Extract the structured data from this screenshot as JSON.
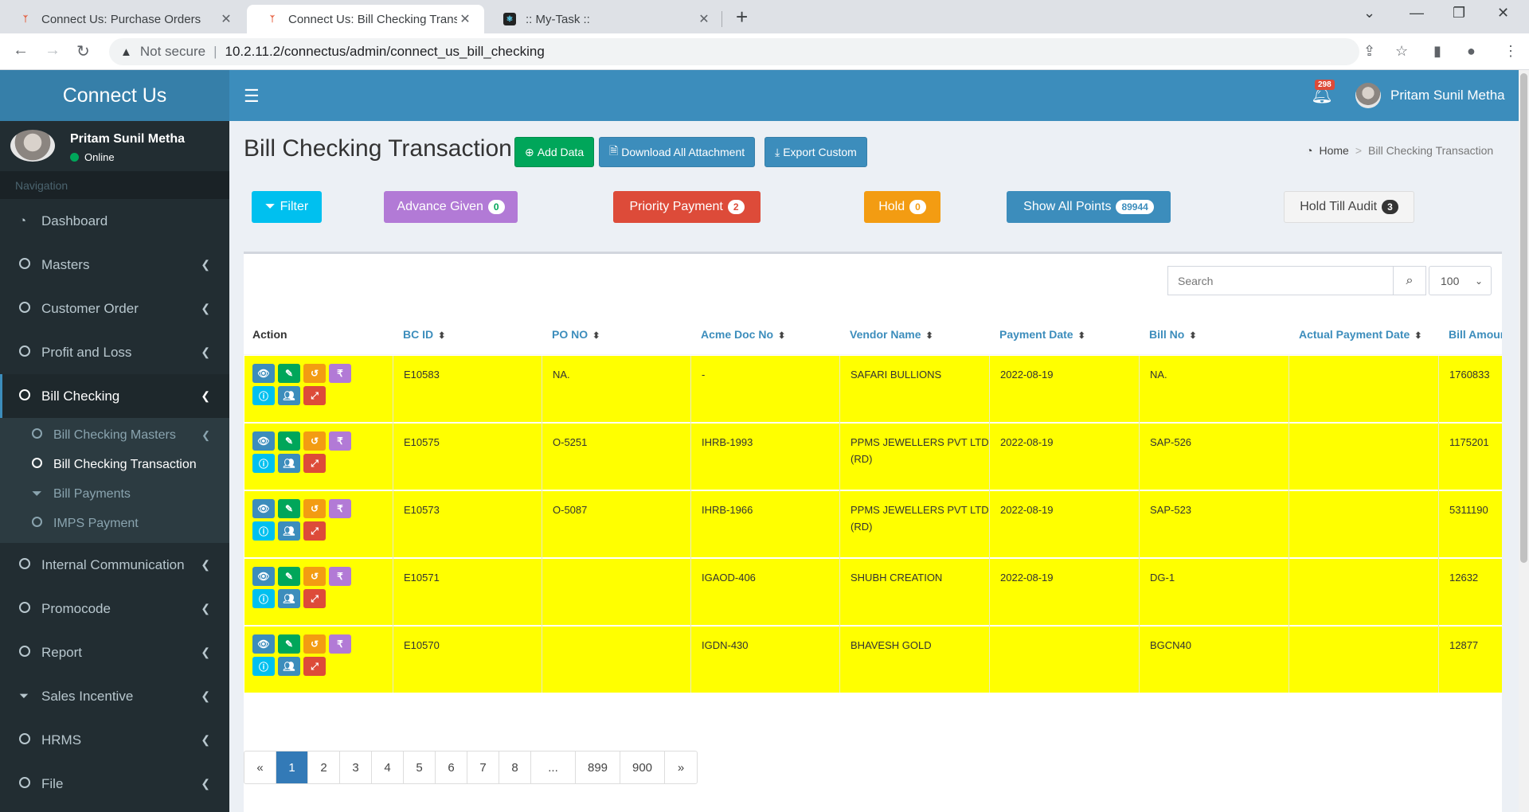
{
  "browser": {
    "tabs": [
      {
        "title": "Connect Us: Purchase Orders"
      },
      {
        "title": "Connect Us: Bill Checking Transac"
      },
      {
        "title": ":: My-Task ::"
      }
    ],
    "security": "Not secure",
    "url": "10.2.11.2/connectus/admin/connect_us_bill_checking"
  },
  "sidebar": {
    "brand": "Connect Us",
    "user_name": "Pritam Sunil Metha",
    "status": "Online",
    "nav_header": "Navigation",
    "items": [
      {
        "label": "Dashboard",
        "icon": "dashboard-icon"
      },
      {
        "label": "Masters",
        "icon": "circle-icon"
      },
      {
        "label": "Customer Order",
        "icon": "circle-icon"
      },
      {
        "label": "Profit and Loss",
        "icon": "circle-icon"
      },
      {
        "label": "Bill Checking",
        "icon": "circle-icon"
      },
      {
        "label": "Internal Communication",
        "icon": "circle-icon"
      },
      {
        "label": "Promocode",
        "icon": "circle-icon"
      },
      {
        "label": "Report",
        "icon": "circle-icon"
      },
      {
        "label": "Sales Incentive",
        "icon": "filter-icon"
      },
      {
        "label": "HRMS",
        "icon": "circle-icon"
      },
      {
        "label": "File",
        "icon": "circle-icon"
      }
    ],
    "sub_items": [
      {
        "label": "Bill Checking Masters"
      },
      {
        "label": "Bill Checking Transaction"
      },
      {
        "label": "Bill Payments"
      },
      {
        "label": "IMPS Payment"
      }
    ]
  },
  "header": {
    "notification_count": "298",
    "user_name": "Pritam Sunil Metha"
  },
  "content": {
    "title": "Bill Checking Transaction",
    "add_data": "Add Data",
    "download_all": "Download All Attachment",
    "export_custom": "Export Custom",
    "breadcrumb_home": "Home",
    "breadcrumb_current": "Bill Checking Transaction"
  },
  "filters": {
    "filter": "Filter",
    "advance_given": {
      "label": "Advance Given",
      "count": "0"
    },
    "priority_payment": {
      "label": "Priority Payment",
      "count": "2"
    },
    "hold": {
      "label": "Hold",
      "count": "0"
    },
    "show_all_points": {
      "label": "Show All Points",
      "count": "89944"
    },
    "hold_till_audit": {
      "label": "Hold Till Audit",
      "count": "3"
    }
  },
  "table": {
    "search_placeholder": "Search",
    "page_size": "100",
    "columns": [
      "Action",
      "BC ID",
      "PO NO",
      "Acme Doc No",
      "Vendor Name",
      "Payment Date",
      "Bill No",
      "Actual Payment Date",
      "Bill Amour"
    ],
    "rows": [
      {
        "bc_id": "E10583",
        "po_no": "NA.",
        "acme_doc": "-",
        "vendor": "SAFARI BULLIONS",
        "payment_date": "2022-08-19",
        "bill_no": "NA.",
        "actual_date": "",
        "amount": "1760833"
      },
      {
        "bc_id": "E10575",
        "po_no": "O-5251",
        "acme_doc": "IHRB-1993",
        "vendor": "PPMS JEWELLERS PVT LTD (RD)",
        "payment_date": "2022-08-19",
        "bill_no": "SAP-526",
        "actual_date": "",
        "amount": "1175201"
      },
      {
        "bc_id": "E10573",
        "po_no": "O-5087",
        "acme_doc": "IHRB-1966",
        "vendor": "PPMS JEWELLERS PVT LTD (RD)",
        "payment_date": "2022-08-19",
        "bill_no": "SAP-523",
        "actual_date": "",
        "amount": "5311190"
      },
      {
        "bc_id": "E10571",
        "po_no": "",
        "acme_doc": "IGAOD-406",
        "vendor": "SHUBH CREATION",
        "payment_date": "2022-08-19",
        "bill_no": "DG-1",
        "actual_date": "",
        "amount": "12632"
      },
      {
        "bc_id": "E10570",
        "po_no": "",
        "acme_doc": "IGDN-430",
        "vendor": "BHAVESH GOLD",
        "payment_date": "",
        "bill_no": "BGCN40",
        "actual_date": "",
        "amount": "12877"
      },
      {
        "bc_id": "",
        "po_no": "",
        "acme_doc": "",
        "vendor": "",
        "payment_date": "",
        "bill_no": "",
        "actual_date": "",
        "amount": ""
      }
    ]
  },
  "pagination": {
    "prev": "«",
    "pages": [
      "1",
      "2",
      "3",
      "4",
      "5",
      "6",
      "7",
      "8",
      "...",
      "899",
      "900"
    ],
    "next": "»",
    "current": "1"
  }
}
